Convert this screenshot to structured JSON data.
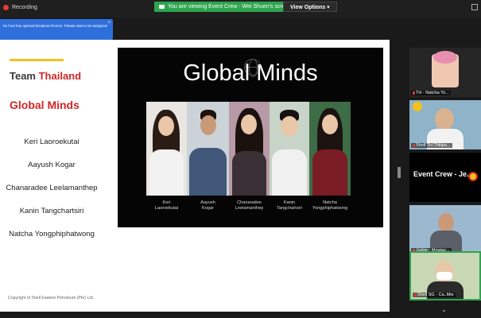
{
  "topbar": {
    "recording_label": "Recording",
    "share_text": "You are viewing Event Crew - Wei Shuen's screen",
    "view_options_label": "View Options",
    "view_options_caret": "▾"
  },
  "notification": {
    "text": "he host has opened Breakout Rooms. Please wait to be assigned.",
    "close_symbol": "×"
  },
  "slide": {
    "team_prefix": "Team ",
    "team_country": "Thailand",
    "group_name": "Global Minds",
    "members": [
      "Keri Laoroekutai",
      "Aayush Kogar",
      "Chanaradee Leelamanthep",
      "Kanin Tangchartsiri",
      "Natcha Yongphiphatwong"
    ],
    "copyright": "Copyright of Shell Eastern Petroleum (Pte) Ltd.",
    "photo_title": "Global Minds",
    "photo_names": [
      [
        "Keri",
        "Laoroekutai"
      ],
      [
        "Aayush",
        "Kogar"
      ],
      [
        "Chanaradee",
        "Leelamanthep"
      ],
      [
        "Kanin",
        "Tangchartsiri"
      ],
      [
        "Natcha",
        "Yongphiphatwong"
      ]
    ]
  },
  "gallery": {
    "tiles": [
      {
        "label": "TH - Natcha Yo..."
      },
      {
        "label": "Shell TH Thitipa..."
      },
      {
        "label": "Event Crew - Je..."
      },
      {
        "label": "Judge - Moataz..."
      },
      {
        "label": "Shell SG - Ca..Mie"
      }
    ]
  },
  "colors": {
    "accent_red": "#d32626",
    "accent_yellow": "#f4c21c",
    "share_green": "#2ea44f",
    "notify_blue": "#2f6fdc"
  }
}
